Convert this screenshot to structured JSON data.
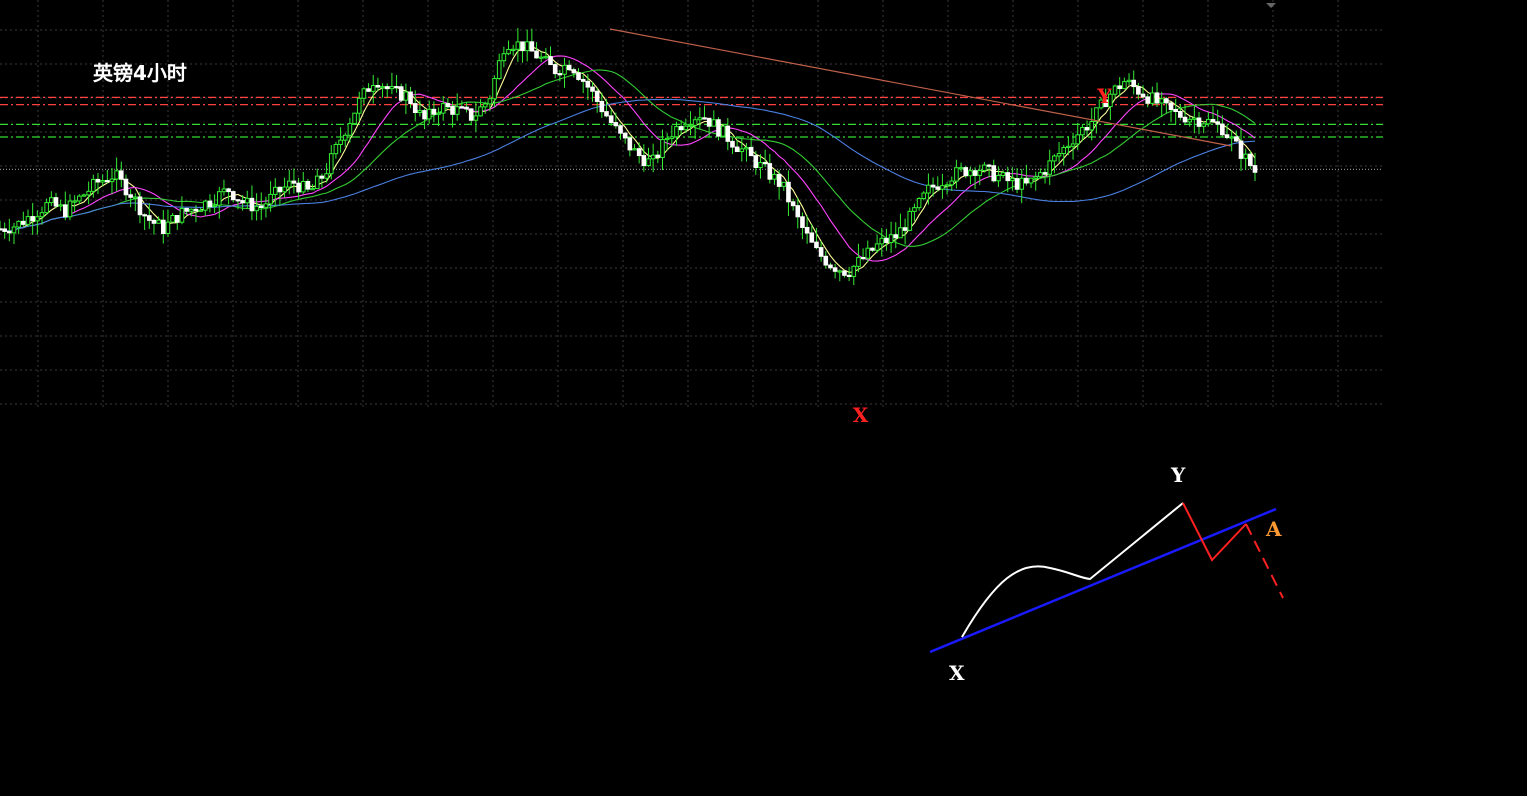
{
  "chart_data": {
    "type": "candlestick",
    "title": "英镑4小时",
    "grid": true,
    "ylim": [
      0,
      100
    ],
    "colors": {
      "background": "#000000",
      "grid": "#3a3a3a",
      "candle": "#33ee33",
      "candle_body": "#ffffff",
      "ma_fast": "#ffff99",
      "ma_mid": "#ff44ff",
      "ma_slow": "#33cc33",
      "ma_long": "#4a7fe0",
      "trendline": "#c0604a",
      "level_red": "#ff4040",
      "level_green": "#33dd33",
      "level_gray": "#888888"
    },
    "horizontal_levels": [
      {
        "value": 78.5,
        "style": "dash-dot",
        "color": "red"
      },
      {
        "value": 76.5,
        "style": "dash-dot",
        "color": "red"
      },
      {
        "value": 71.0,
        "style": "dash-dot",
        "color": "green"
      },
      {
        "value": 67.5,
        "style": "dash-dot",
        "color": "green"
      },
      {
        "value": 58.5,
        "style": "dotted",
        "color": "gray"
      }
    ],
    "trendline": {
      "from": [
        0.0,
        97.5
      ],
      "to": [
        0.95,
        65.0
      ]
    },
    "price_path": [
      [
        0.0,
        42
      ],
      [
        0.02,
        43
      ],
      [
        0.04,
        46
      ],
      [
        0.06,
        49
      ],
      [
        0.08,
        47
      ],
      [
        0.1,
        51
      ],
      [
        0.12,
        55
      ],
      [
        0.14,
        57
      ],
      [
        0.16,
        52
      ],
      [
        0.18,
        45
      ],
      [
        0.2,
        42
      ],
      [
        0.22,
        46
      ],
      [
        0.24,
        48
      ],
      [
        0.26,
        50
      ],
      [
        0.28,
        53
      ],
      [
        0.3,
        49
      ],
      [
        0.32,
        48
      ],
      [
        0.34,
        52
      ],
      [
        0.36,
        55
      ],
      [
        0.38,
        52
      ],
      [
        0.4,
        58
      ],
      [
        0.42,
        68
      ],
      [
        0.44,
        77
      ],
      [
        0.46,
        84
      ],
      [
        0.48,
        80
      ],
      [
        0.5,
        79
      ],
      [
        0.52,
        72
      ],
      [
        0.54,
        76
      ],
      [
        0.56,
        75
      ],
      [
        0.58,
        73
      ],
      [
        0.6,
        78
      ],
      [
        0.62,
        94
      ],
      [
        0.64,
        93
      ],
      [
        0.66,
        90
      ],
      [
        0.68,
        86
      ],
      [
        0.7,
        88
      ],
      [
        0.72,
        82
      ],
      [
        0.74,
        75
      ],
      [
        0.76,
        68
      ],
      [
        0.78,
        63
      ],
      [
        0.8,
        60
      ],
      [
        0.82,
        68
      ],
      [
        0.84,
        72
      ],
      [
        0.86,
        74
      ],
      [
        0.88,
        70
      ],
      [
        0.9,
        66
      ],
      [
        0.92,
        62
      ],
      [
        0.94,
        58
      ],
      [
        0.96,
        54
      ],
      [
        0.98,
        44
      ],
      [
        1.0,
        36
      ],
      [
        1.02,
        32
      ],
      [
        1.04,
        30
      ],
      [
        1.06,
        34
      ],
      [
        1.08,
        38
      ],
      [
        1.1,
        40
      ],
      [
        1.12,
        46
      ],
      [
        1.14,
        53
      ],
      [
        1.16,
        56
      ],
      [
        1.18,
        58
      ],
      [
        1.2,
        59
      ],
      [
        1.22,
        57
      ],
      [
        1.24,
        55
      ],
      [
        1.26,
        54
      ],
      [
        1.28,
        58
      ],
      [
        1.3,
        63
      ],
      [
        1.32,
        68
      ],
      [
        1.34,
        72
      ],
      [
        1.36,
        79
      ],
      [
        1.38,
        83
      ],
      [
        1.4,
        80
      ],
      [
        1.42,
        77
      ],
      [
        1.44,
        74
      ],
      [
        1.46,
        73
      ],
      [
        1.48,
        72
      ],
      [
        1.5,
        70
      ],
      [
        1.52,
        64
      ],
      [
        1.54,
        58
      ]
    ],
    "points": [
      {
        "label": "Y",
        "x": 1.355,
        "y": 89,
        "color": "#ff2020"
      },
      {
        "label": "X",
        "x": 1.055,
        "y": 0,
        "color": "#ff2020"
      }
    ]
  },
  "diagram": {
    "labels": [
      {
        "text": "Y",
        "color": "#ffffff"
      },
      {
        "text": "X",
        "color": "#ffffff"
      },
      {
        "text": "A",
        "color": "#ff9933"
      }
    ],
    "lines": {
      "trend": "#1a1aff",
      "wave": "#ffffff",
      "correction": "#ff2020"
    }
  }
}
